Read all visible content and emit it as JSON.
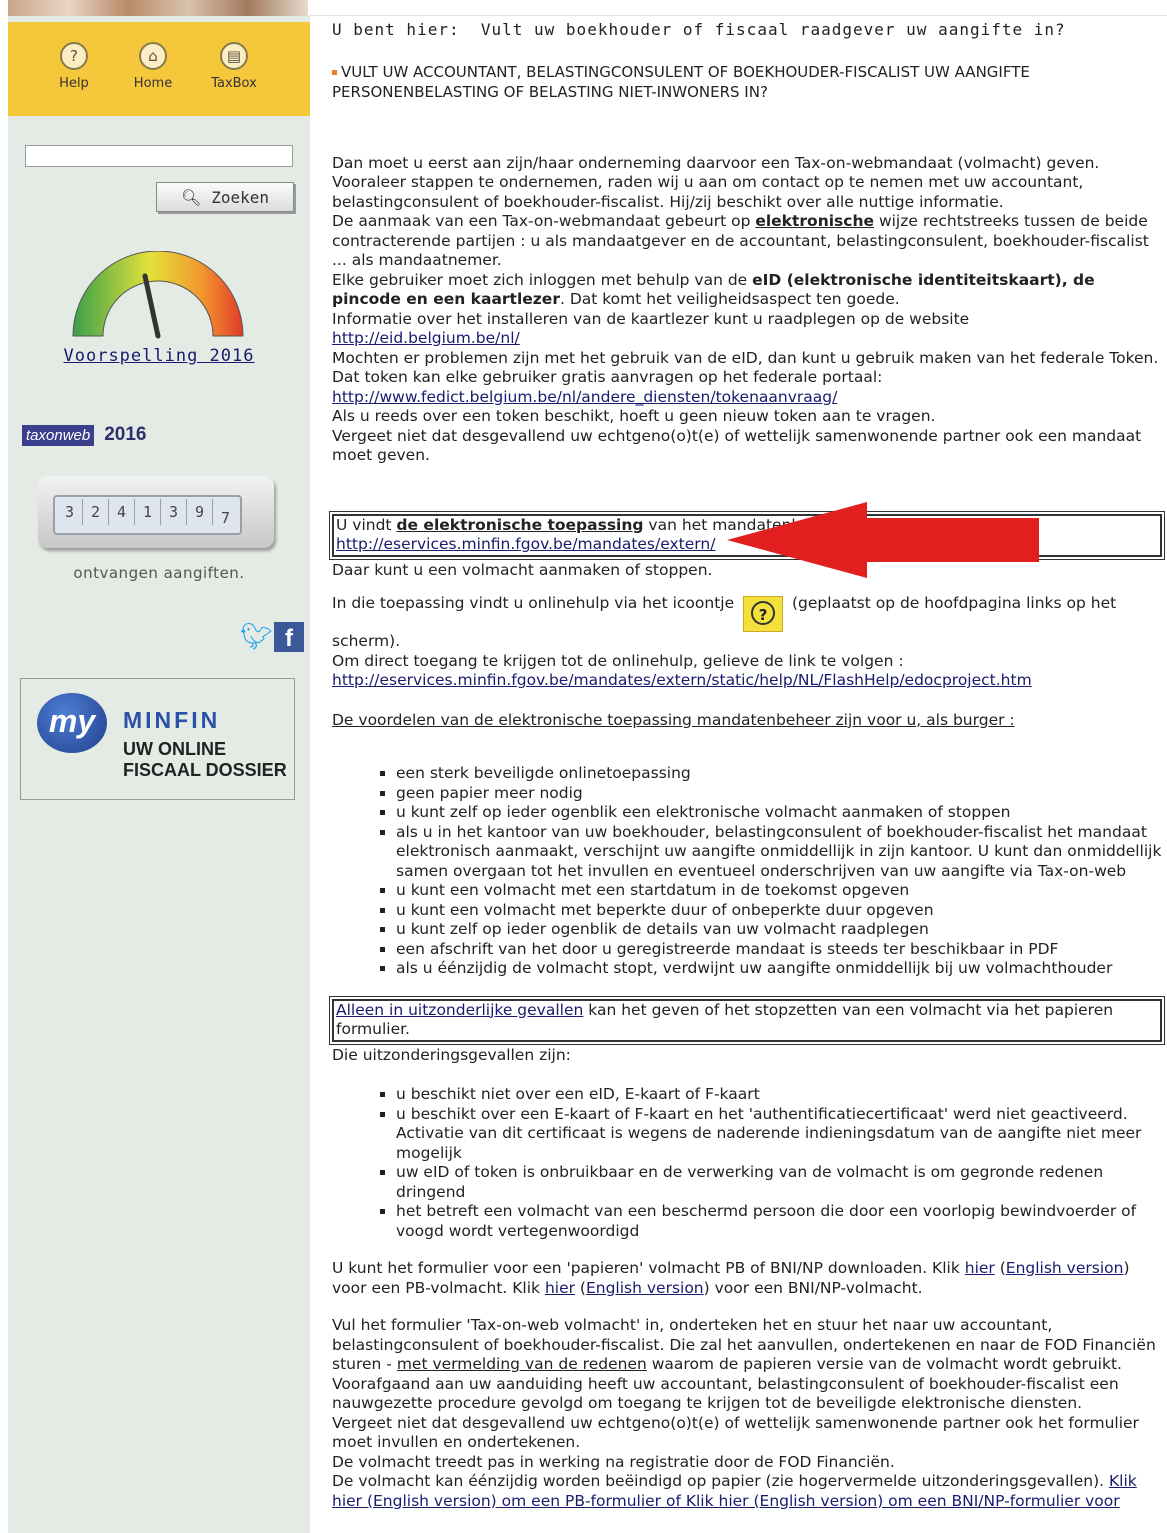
{
  "sidebar": {
    "nav": [
      {
        "label": "Help",
        "icon": "question-icon"
      },
      {
        "label": "Home",
        "icon": "home-icon"
      },
      {
        "label": "TaxBox",
        "icon": "taxbox-icon"
      }
    ],
    "search": {
      "value": "",
      "button_label": "Zoeken"
    },
    "forecast_link": "Voorspelling 2016",
    "taxonweb_logo": "taxonweb",
    "taxonweb_year": "2016",
    "counter_digits": [
      "3",
      "2",
      "4",
      "1",
      "3",
      "9",
      "7"
    ],
    "received_label": "ontvangen aangiften.",
    "social": [
      "twitter-icon",
      "facebook-icon"
    ],
    "minfin": {
      "my": "my",
      "title": "MINFIN",
      "line1": "UW ONLINE",
      "line2": "FISCAAL DOSSIER"
    }
  },
  "main": {
    "breadcrumb_label": "U bent hier:",
    "breadcrumb_value": "Vult uw boekhouder of fiscaal raadgever uw aangifte in?",
    "heading": "VULT UW ACCOUNTANT, BELASTINGCONSULENT OF BOEKHOUDER-FISCALIST UW AANGIFTE PERSONENBELASTING OF BELASTING NIET-INWONERS IN?",
    "intro": {
      "p1": "Dan moet u eerst aan zijn/haar onderneming daarvoor een Tax-on-webmandaat (volmacht) geven. Vooraleer stappen te ondernemen, raden wij u aan om contact op te nemen met uw accountant, belastingconsulent of boekhouder-fiscalist. Hij/zij beschikt over alle nuttige informatie.",
      "p2a": "De aanmaak van een Tax-on-webmandaat gebeurt op ",
      "p2b": "elektronische",
      "p2c": " wijze rechtstreeks tussen de beide contracterende partijen : u als mandaatgever en de accountant, belastingconsulent, boekhouder-fiscalist ... als mandaatnemer.",
      "p3a": "Elke gebruiker moet zich inloggen met behulp van de ",
      "p3b": "eID (elektronische identiteitskaart), de pincode en een kaartlezer",
      "p3c": ". Dat komt het veiligheidsaspect ten goede.",
      "p4": "Informatie over het installeren van de kaartlezer kunt u raadplegen op de website",
      "p4_link": "http://eid.belgium.be/nl/",
      "p5": "Mochten er problemen zijn met het gebruik van de eID, dan kunt u gebruik maken van het federale Token. Dat token kan elke gebruiker gratis aanvragen op het federale portaal:",
      "p5_link": "http://www.fedict.belgium.be/nl/andere_diensten/tokenaanvraag/",
      "p6": "Als u reeds over een token beschikt, hoeft u geen nieuw token aan te vragen.",
      "p7": "Vergeet niet dat desgevallend uw echtgeno(o)t(e) of wettelijk samenwonende partner ook een mandaat moet geven."
    },
    "linkbox": {
      "a": "U vindt ",
      "b": "de elektronische toepassing",
      "c": " van het mandatenbeheer via de volgende link :",
      "link": "http://eservices.minfin.fgov.be/mandates/extern/"
    },
    "after_box": "Daar kunt u een volmacht aanmaken of stoppen.",
    "help": {
      "a": "In die toepassing vindt u onlinehulp via het icoontje",
      "b": "(geplaatst op de hoofdpagina links op het scherm).",
      "c": "Om direct toegang te krijgen tot de onlinehulp, gelieve de link te volgen :",
      "link": "http://eservices.minfin.fgov.be/mandates/extern/static/help/NL/FlashHelp/edocproject.htm"
    },
    "advantages_title": "De voordelen van de elektronische toepassing mandatenbeheer zijn voor u, als burger :",
    "advantages": [
      "een sterk beveiligde onlinetoepassing",
      "geen papier meer nodig",
      "u kunt zelf op ieder ogenblik een elektronische volmacht aanmaken of stoppen",
      "als u in het kantoor van uw boekhouder, belastingconsulent of boekhouder-fiscalist het mandaat elektronisch aanmaakt, verschijnt uw aangifte onmiddellijk in zijn kantoor. U kunt dan onmiddellijk samen overgaan tot het invullen en eventueel onderschrijven van uw aangifte via Tax-on-web",
      "u kunt een volmacht met een startdatum in de toekomst opgeven",
      "u kunt een volmacht met beperkte duur of onbeperkte duur opgeven",
      "u kunt zelf op ieder ogenblik de details van uw volmacht raadplegen",
      "een afschrift van het door u geregistreerde mandaat is steeds ter beschikbaar in PDF",
      "als u éénzijdig de volmacht stopt, verdwijnt uw aangifte onmiddellijk bij uw volmachthouder"
    ],
    "exception_box": {
      "a": "Alleen in uitzonderlijke gevallen",
      "b": " kan het geven of het stopzetten van een volmacht via het papieren formulier."
    },
    "exceptions_title": "Die uitzonderingsgevallen zijn:",
    "exceptions": [
      "u beschikt niet over een eID, E-kaart of F-kaart",
      "u beschikt over een E-kaart of F-kaart en het 'authentificatiecertificaat' werd niet geactiveerd. Activatie van dit certificaat is wegens de naderende indieningsdatum van de aangifte niet meer mogelijk",
      "uw eID of token is onbruikbaar en de verwerking van de volmacht is om gegronde redenen dringend",
      "het betreft een volmacht van een beschermd persoon die door een voorlopig bewindvoerder of voogd wordt vertegenwoordigd"
    ],
    "download": {
      "a": "U kunt het formulier voor een 'papieren' volmacht PB of BNI/NP downloaden. Klik ",
      "hier": "hier",
      "english": "English version",
      "b": " voor een PB-volmacht. Klik ",
      "c": " voor een BNI/NP-volmacht."
    },
    "final": {
      "p1a": "Vul het formulier 'Tax-on-web volmacht' in, onderteken het en stuur het naar uw accountant, belastingconsulent of boekhouder-fiscalist. Die zal het aanvullen, ondertekenen en naar de FOD Financiën sturen - ",
      "p1b": "met vermelding van de redenen",
      "p1c": " waarom de papieren versie van de volmacht wordt gebruikt.",
      "p2": "Voorafgaand aan uw aanduiding heeft uw accountant, belastingconsulent of boekhouder-fiscalist een nauwgezette procedure gevolgd om toegang te krijgen tot de beveiligde elektronische diensten.",
      "p3": "Vergeet niet dat desgevallend uw echtgeno(o)t(e) of wettelijk samenwonende partner ook het formulier moet invullen en ondertekenen.",
      "p4": "De volmacht treedt pas in werking na registratie door de FOD Financiën.",
      "p5a": "De volmacht kan éénzijdig worden beëindigd op papier (zie hogervermelde uitzonderingsgevallen). ",
      "p5b": "Klik hier (English version) om een PB-formulier of Klik hier (English version) om een BNI/NP-formulier voor"
    }
  }
}
